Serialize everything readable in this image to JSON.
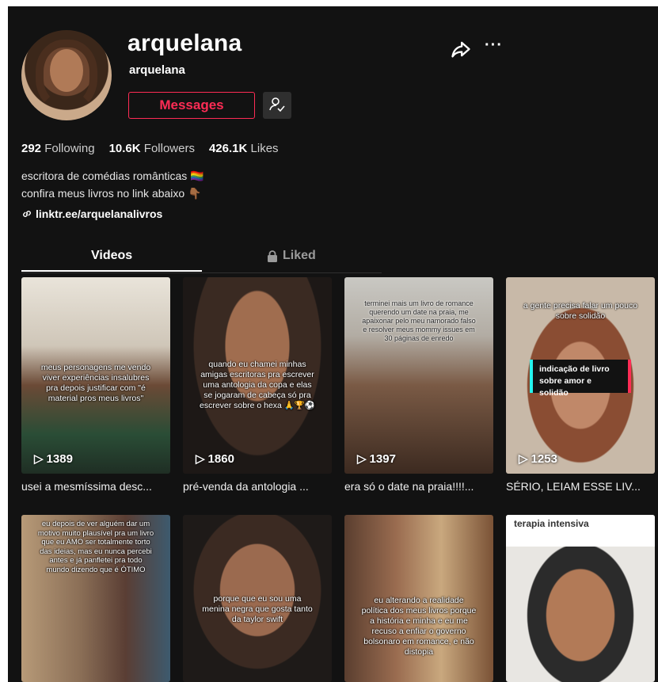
{
  "profile": {
    "title": "arquelana",
    "subtitle": "arquelana",
    "messages_label": "Messages",
    "stats": {
      "following_count": "292",
      "following_label": "Following",
      "followers_count": "10.6K",
      "followers_label": "Followers",
      "likes_count": "426.1K",
      "likes_label": "Likes"
    },
    "bio_line1": "escritora de comédias românticas 🏳️‍🌈",
    "bio_line2": "confira meus livros no link abaixo 👇🏾",
    "link": "linktr.ee/arquelanalivros"
  },
  "tabs": {
    "videos": "Videos",
    "liked": "Liked"
  },
  "videos": [
    {
      "views": "1389",
      "caption": "usei a mesmíssima desc...",
      "overlay": "meus personagens me vendo viver experiências insalubres pra depois justificar com \"é material pros meus livros\""
    },
    {
      "views": "1860",
      "caption": "pré-venda da antologia ...",
      "overlay": "quando eu chamei minhas amigas escritoras pra escrever uma antologia da copa e elas se jogaram de cabeça só pra escrever sobre o hexa 🙏🏆⚽"
    },
    {
      "views": "1397",
      "caption": "era só o date na praia!!!!...",
      "overlay": "terminei mais um livro de romance querendo um date na praia, me apaixonar pelo meu namorado falso e resolver meus mommy issues em 30 páginas de enredo"
    },
    {
      "views": "1253",
      "caption": "SÉRIO, LEIAM ESSE LIV...",
      "overlay": "a gente precisa falar um pouco sobre solidão",
      "box": "indicação de livro sobre amor e solidão"
    },
    {
      "overlay": "eu depois de ver alguém dar um motivo muito plausível pra um livro que eu AMO ser totalmente torto das ideias, mas eu nunca percebi antes e já panfletei pra todo mundo dizendo que é ÓTIMO"
    },
    {
      "overlay": "porque que eu sou uma menina negra que gosta tanto da taylor swift"
    },
    {
      "overlay": "eu alterando a realidade política dos meus livros porque a história e minha e eu me recuso a enfiar o governo bolsonaro em romance, e não distopia"
    },
    {
      "header": "terapia intensiva"
    }
  ],
  "colors": {
    "background": "#121212",
    "accent": "#fe2c55",
    "cyan": "#25f4ee"
  }
}
